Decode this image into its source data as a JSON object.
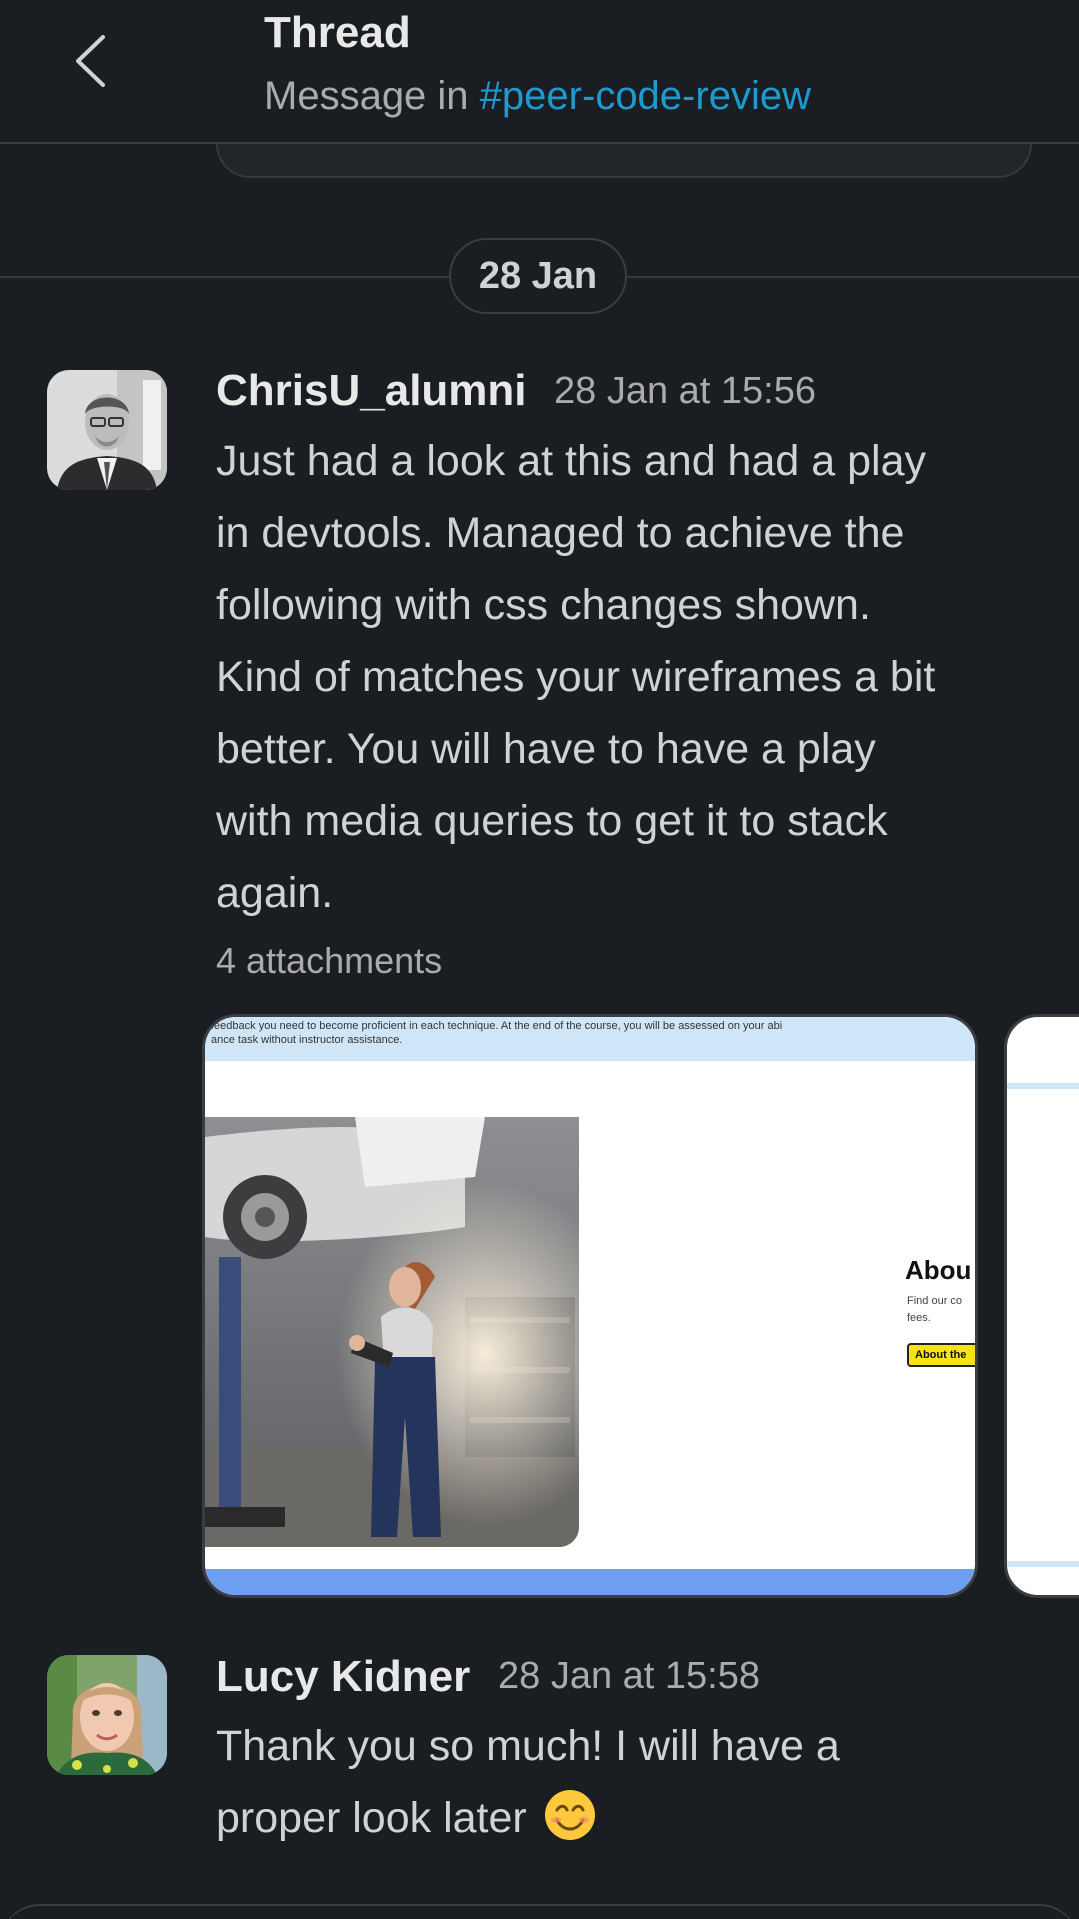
{
  "header": {
    "title": "Thread",
    "subtitle_prefix": "Message in",
    "channel": "#peer-code-review"
  },
  "date_divider": "28 Jan",
  "messages": [
    {
      "author": "ChrisU_alumni",
      "time": "28 Jan at 15:56",
      "lines": [
        "Just had a look at this and had a play",
        "in devtools. Managed to achieve the",
        "following with css changes shown.",
        "Kind of matches your wireframes a bit",
        "better.  You will have to have a play",
        "with media queries to get it to stack",
        "again."
      ],
      "attachments_label": "4 attachments",
      "attachment_preview": {
        "top_text_line1": "feedback you need to become proficient in each technique. At the end of the course, you will be assessed on your abi",
        "top_text_line2": "ance task without instructor assistance.",
        "heading": "Abou",
        "body": "Find our co fees.",
        "button": "About the"
      }
    },
    {
      "author": "Lucy Kidner",
      "time": "28 Jan at 15:58",
      "lines": [
        "Thank you so much! I will have a",
        "proper look later"
      ],
      "emoji": "smiling-face-emoji"
    }
  ],
  "colors": {
    "background": "#1a1d21",
    "link": "#1d9bd1",
    "text": "#d1d2d3",
    "muted": "#ababad"
  }
}
